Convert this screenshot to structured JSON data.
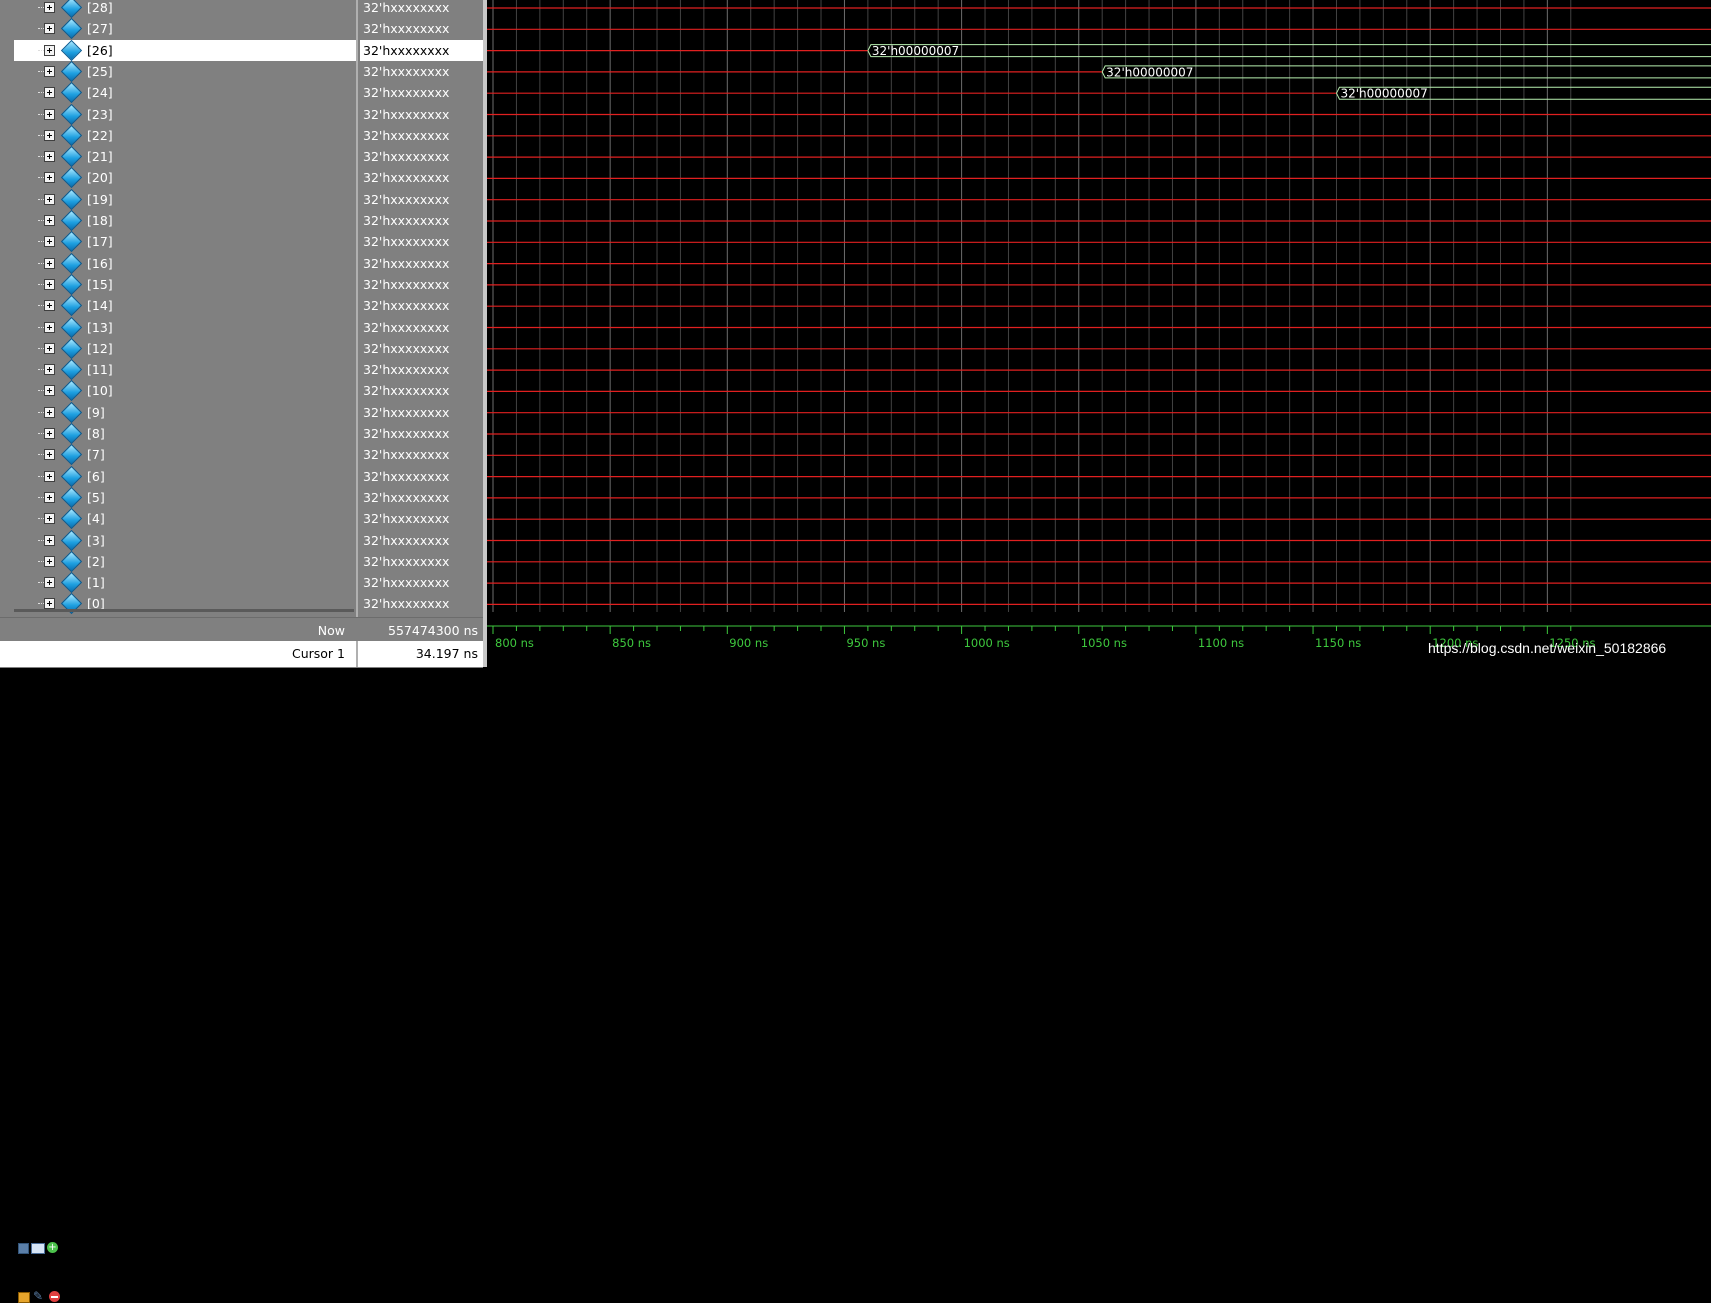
{
  "signals": [
    {
      "name": "[28]",
      "value": "32'hxxxxxxxx",
      "selected": false
    },
    {
      "name": "[27]",
      "value": "32'hxxxxxxxx",
      "selected": false
    },
    {
      "name": "[26]",
      "value": "32'hxxxxxxxx",
      "selected": true
    },
    {
      "name": "[25]",
      "value": "32'hxxxxxxxx",
      "selected": false
    },
    {
      "name": "[24]",
      "value": "32'hxxxxxxxx",
      "selected": false
    },
    {
      "name": "[23]",
      "value": "32'hxxxxxxxx",
      "selected": false
    },
    {
      "name": "[22]",
      "value": "32'hxxxxxxxx",
      "selected": false
    },
    {
      "name": "[21]",
      "value": "32'hxxxxxxxx",
      "selected": false
    },
    {
      "name": "[20]",
      "value": "32'hxxxxxxxx",
      "selected": false
    },
    {
      "name": "[19]",
      "value": "32'hxxxxxxxx",
      "selected": false
    },
    {
      "name": "[18]",
      "value": "32'hxxxxxxxx",
      "selected": false
    },
    {
      "name": "[17]",
      "value": "32'hxxxxxxxx",
      "selected": false
    },
    {
      "name": "[16]",
      "value": "32'hxxxxxxxx",
      "selected": false
    },
    {
      "name": "[15]",
      "value": "32'hxxxxxxxx",
      "selected": false
    },
    {
      "name": "[14]",
      "value": "32'hxxxxxxxx",
      "selected": false
    },
    {
      "name": "[13]",
      "value": "32'hxxxxxxxx",
      "selected": false
    },
    {
      "name": "[12]",
      "value": "32'hxxxxxxxx",
      "selected": false
    },
    {
      "name": "[11]",
      "value": "32'hxxxxxxxx",
      "selected": false
    },
    {
      "name": "[10]",
      "value": "32'hxxxxxxxx",
      "selected": false
    },
    {
      "name": "[9]",
      "value": "32'hxxxxxxxx",
      "selected": false
    },
    {
      "name": "[8]",
      "value": "32'hxxxxxxxx",
      "selected": false
    },
    {
      "name": "[7]",
      "value": "32'hxxxxxxxx",
      "selected": false
    },
    {
      "name": "[6]",
      "value": "32'hxxxxxxxx",
      "selected": false
    },
    {
      "name": "[5]",
      "value": "32'hxxxxxxxx",
      "selected": false
    },
    {
      "name": "[4]",
      "value": "32'hxxxxxxxx",
      "selected": false
    },
    {
      "name": "[3]",
      "value": "32'hxxxxxxxx",
      "selected": false
    },
    {
      "name": "[2]",
      "value": "32'hxxxxxxxx",
      "selected": false
    },
    {
      "name": "[1]",
      "value": "32'hxxxxxxxx",
      "selected": false
    },
    {
      "name": "[0]",
      "value": "32'hxxxxxxxx",
      "selected": false
    }
  ],
  "waveform": {
    "time_start_ns": 800,
    "time_end_ns": 1260,
    "major_tick_step_ns": 50,
    "bus_transitions": [
      {
        "signal": "[26]",
        "time_ns": 960,
        "label": "32'h00000007"
      },
      {
        "signal": "[25]",
        "time_ns": 1060,
        "label": "32'h00000007"
      },
      {
        "signal": "[24]",
        "time_ns": 1160,
        "label": "32'h00000007"
      }
    ],
    "colors": {
      "undefined": "#e02020",
      "valid": "#b8f0b0",
      "grid": "#7a7a7a",
      "ruler_text": "#3ec83e"
    }
  },
  "ruler": {
    "labels": [
      "800 ns",
      "850 ns",
      "900 ns",
      "950 ns",
      "1000 ns",
      "1050 ns",
      "1100 ns",
      "1150 ns",
      "1200 ns",
      "1250 ns"
    ]
  },
  "status": {
    "now_label": "Now",
    "now_value": "557474300 ns",
    "cursor_label": "Cursor 1",
    "cursor_value": "34.197 ns"
  },
  "watermark": "https://blog.csdn.net/weixin_50182866"
}
